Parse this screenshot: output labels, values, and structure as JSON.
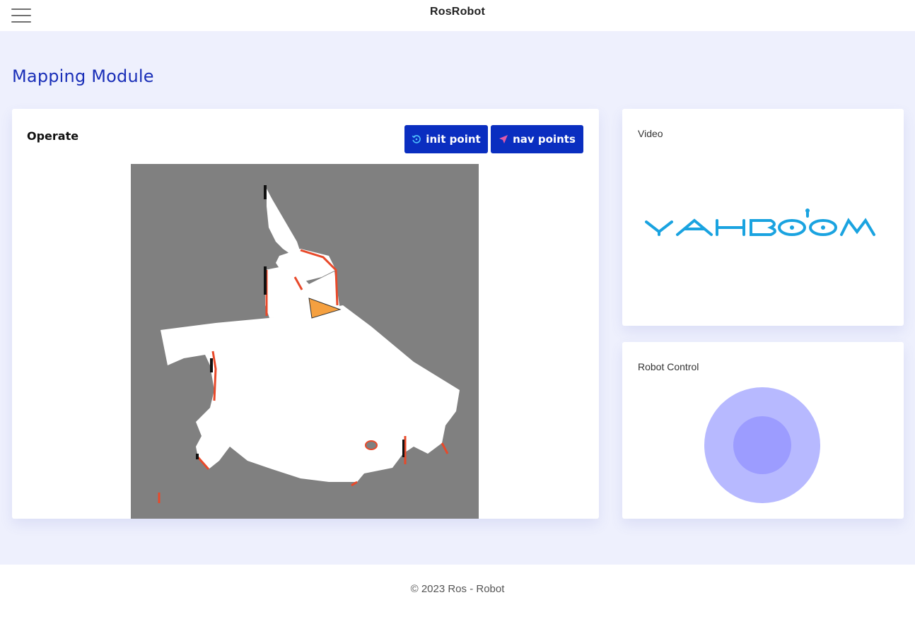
{
  "header": {
    "title": "RosRobot",
    "menu_icon": "hamburger-menu-icon"
  },
  "page": {
    "heading": "Mapping Module"
  },
  "operate": {
    "title": "Operate",
    "init_point_label": "init point",
    "nav_points_label": "nav points",
    "init_icon": "reset-icon",
    "nav_icon": "navigation-arrow-icon"
  },
  "video": {
    "title": "Video",
    "logo_text": "YAHBOOM"
  },
  "robot_control": {
    "title": "Robot Control"
  },
  "footer": {
    "text": "© 2023 Ros - Robot"
  },
  "colors": {
    "accent": "#0a2ec0",
    "heading": "#1a2fb8",
    "page_bg": "#eef0fd",
    "map_unknown": "#808080",
    "map_free": "#ffffff",
    "map_obstacle": "#e8492a",
    "robot_marker": "#f5a040",
    "joystick_outer": "#b7b9ff",
    "joystick_inner": "#9c9cff",
    "logo": "#1aa3e0"
  }
}
